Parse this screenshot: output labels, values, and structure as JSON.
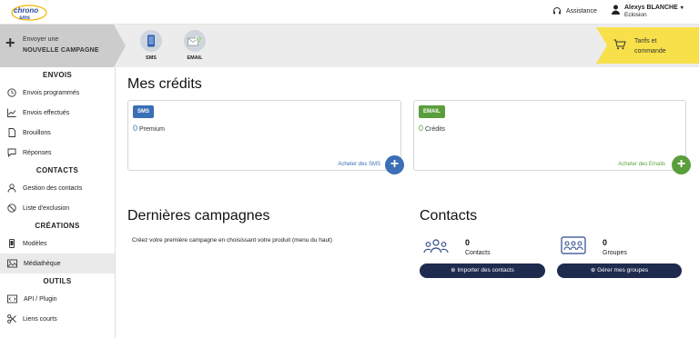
{
  "header": {
    "logo_text": "chrono sms",
    "assistance_label": "Assistance",
    "user_name": "Alexys BLANCHE",
    "user_org": "Eclosion"
  },
  "campaign_bar": {
    "new_line1": "Envoyer une",
    "new_line2": "NOUVELLE CAMPAGNE",
    "channels": [
      {
        "label": "SMS",
        "icon": "phone-icon"
      },
      {
        "label": "EMAIL",
        "icon": "email-icon"
      }
    ],
    "tarifs_line1": "Tarifs et",
    "tarifs_line2": "commande"
  },
  "sidebar": {
    "sections": [
      {
        "title": "ENVOIS",
        "items": [
          "Envois programmés",
          "Envois effectués",
          "Brouillons",
          "Réponses"
        ]
      },
      {
        "title": "CONTACTS",
        "items": [
          "Gestion des contacts",
          "Liste d'exclusion"
        ]
      },
      {
        "title": "CRÉATIONS",
        "items": [
          "Modèles",
          "Médiathèque"
        ]
      },
      {
        "title": "OUTILS",
        "items": [
          "API / Plugin",
          "Liens courts"
        ]
      }
    ],
    "active_item": "Médiathèque"
  },
  "credits": {
    "title": "Mes crédits",
    "sms": {
      "badge": "SMS",
      "value": "0",
      "unit": "Premium",
      "link": "Acheter des SMS"
    },
    "email": {
      "badge": "EMAIL",
      "value": "0",
      "unit": "Crédits",
      "link": "Acheter des Emails"
    }
  },
  "campaigns": {
    "title": "Dernières campagnes",
    "empty_text": "Créez votre première campagne en choisissant votre produit (menu du haut)"
  },
  "contacts": {
    "title": "Contacts",
    "contacts_count": "0",
    "contacts_label": "Contacts",
    "groups_count": "0",
    "groups_label": "Groupes",
    "import_button": "Importer des contacts",
    "groups_button": "Gérer mes groupes"
  },
  "colors": {
    "sms_blue": "#3b6fb6",
    "email_green": "#5a9e3c",
    "tarifs_yellow": "#f8e04a",
    "navy": "#1e2a4e"
  }
}
